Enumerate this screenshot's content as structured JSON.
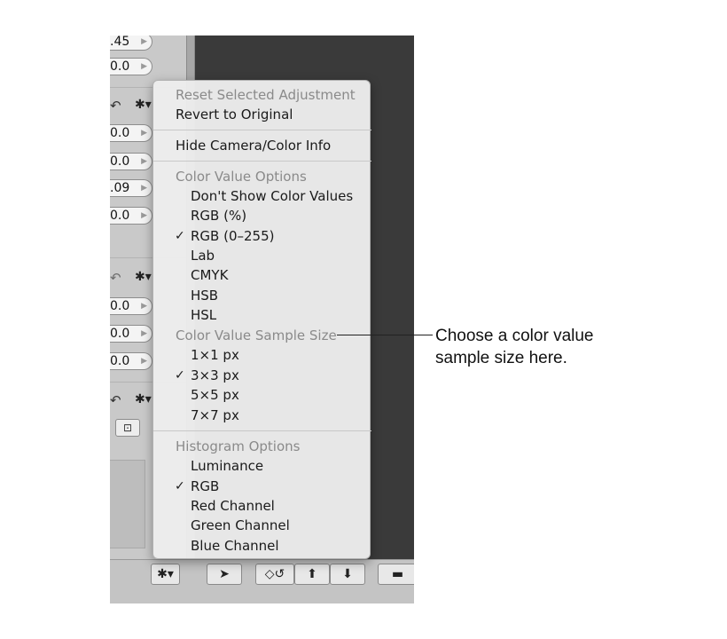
{
  "left_panel": {
    "fields": [
      ".45",
      "0.0",
      "0.0",
      "0.0",
      ".09",
      "0.0",
      "0.0",
      "0.0",
      "0.0"
    ],
    "undo_glyph": "↶",
    "gear_glyph": "✱▾",
    "crop_glyph": "⊡"
  },
  "menu": {
    "reset": "Reset Selected Adjustment",
    "revert": "Revert to Original",
    "hide_info": "Hide Camera/Color Info",
    "color_value_header": "Color Value Options",
    "color_value_options": [
      "Don't Show Color Values",
      "RGB (%)",
      "RGB (0–255)",
      "Lab",
      "CMYK",
      "HSB",
      "HSL"
    ],
    "sample_size_header": "Color Value Sample Size",
    "sample_sizes": [
      "1×1 px",
      "3×3 px",
      "5×5 px",
      "7×7 px"
    ],
    "histogram_header": "Histogram Options",
    "histogram_options": [
      "Luminance",
      "RGB",
      "Red Channel",
      "Green Channel",
      "Blue Channel"
    ],
    "checkmark": "✓"
  },
  "bottom_bar": {
    "gear_glyph": "✱▾",
    "select_glyph": "➤",
    "rotate_glyph": "◇↺",
    "lift_glyph": "⬆",
    "stamp_glyph": "⬇",
    "straighten_glyph": "▬"
  },
  "callout": {
    "text": "Choose a color value sample size here."
  }
}
